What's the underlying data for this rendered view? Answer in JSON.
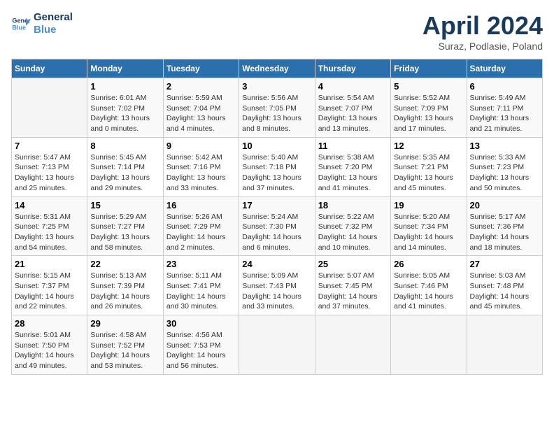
{
  "header": {
    "logo_line1": "General",
    "logo_line2": "Blue",
    "title": "April 2024",
    "subtitle": "Suraz, Podlasie, Poland"
  },
  "calendar": {
    "days_of_week": [
      "Sunday",
      "Monday",
      "Tuesday",
      "Wednesday",
      "Thursday",
      "Friday",
      "Saturday"
    ],
    "weeks": [
      [
        {
          "day": "",
          "info": ""
        },
        {
          "day": "1",
          "info": "Sunrise: 6:01 AM\nSunset: 7:02 PM\nDaylight: 13 hours\nand 0 minutes."
        },
        {
          "day": "2",
          "info": "Sunrise: 5:59 AM\nSunset: 7:04 PM\nDaylight: 13 hours\nand 4 minutes."
        },
        {
          "day": "3",
          "info": "Sunrise: 5:56 AM\nSunset: 7:05 PM\nDaylight: 13 hours\nand 8 minutes."
        },
        {
          "day": "4",
          "info": "Sunrise: 5:54 AM\nSunset: 7:07 PM\nDaylight: 13 hours\nand 13 minutes."
        },
        {
          "day": "5",
          "info": "Sunrise: 5:52 AM\nSunset: 7:09 PM\nDaylight: 13 hours\nand 17 minutes."
        },
        {
          "day": "6",
          "info": "Sunrise: 5:49 AM\nSunset: 7:11 PM\nDaylight: 13 hours\nand 21 minutes."
        }
      ],
      [
        {
          "day": "7",
          "info": "Sunrise: 5:47 AM\nSunset: 7:13 PM\nDaylight: 13 hours\nand 25 minutes."
        },
        {
          "day": "8",
          "info": "Sunrise: 5:45 AM\nSunset: 7:14 PM\nDaylight: 13 hours\nand 29 minutes."
        },
        {
          "day": "9",
          "info": "Sunrise: 5:42 AM\nSunset: 7:16 PM\nDaylight: 13 hours\nand 33 minutes."
        },
        {
          "day": "10",
          "info": "Sunrise: 5:40 AM\nSunset: 7:18 PM\nDaylight: 13 hours\nand 37 minutes."
        },
        {
          "day": "11",
          "info": "Sunrise: 5:38 AM\nSunset: 7:20 PM\nDaylight: 13 hours\nand 41 minutes."
        },
        {
          "day": "12",
          "info": "Sunrise: 5:35 AM\nSunset: 7:21 PM\nDaylight: 13 hours\nand 45 minutes."
        },
        {
          "day": "13",
          "info": "Sunrise: 5:33 AM\nSunset: 7:23 PM\nDaylight: 13 hours\nand 50 minutes."
        }
      ],
      [
        {
          "day": "14",
          "info": "Sunrise: 5:31 AM\nSunset: 7:25 PM\nDaylight: 13 hours\nand 54 minutes."
        },
        {
          "day": "15",
          "info": "Sunrise: 5:29 AM\nSunset: 7:27 PM\nDaylight: 13 hours\nand 58 minutes."
        },
        {
          "day": "16",
          "info": "Sunrise: 5:26 AM\nSunset: 7:29 PM\nDaylight: 14 hours\nand 2 minutes."
        },
        {
          "day": "17",
          "info": "Sunrise: 5:24 AM\nSunset: 7:30 PM\nDaylight: 14 hours\nand 6 minutes."
        },
        {
          "day": "18",
          "info": "Sunrise: 5:22 AM\nSunset: 7:32 PM\nDaylight: 14 hours\nand 10 minutes."
        },
        {
          "day": "19",
          "info": "Sunrise: 5:20 AM\nSunset: 7:34 PM\nDaylight: 14 hours\nand 14 minutes."
        },
        {
          "day": "20",
          "info": "Sunrise: 5:17 AM\nSunset: 7:36 PM\nDaylight: 14 hours\nand 18 minutes."
        }
      ],
      [
        {
          "day": "21",
          "info": "Sunrise: 5:15 AM\nSunset: 7:37 PM\nDaylight: 14 hours\nand 22 minutes."
        },
        {
          "day": "22",
          "info": "Sunrise: 5:13 AM\nSunset: 7:39 PM\nDaylight: 14 hours\nand 26 minutes."
        },
        {
          "day": "23",
          "info": "Sunrise: 5:11 AM\nSunset: 7:41 PM\nDaylight: 14 hours\nand 30 minutes."
        },
        {
          "day": "24",
          "info": "Sunrise: 5:09 AM\nSunset: 7:43 PM\nDaylight: 14 hours\nand 33 minutes."
        },
        {
          "day": "25",
          "info": "Sunrise: 5:07 AM\nSunset: 7:45 PM\nDaylight: 14 hours\nand 37 minutes."
        },
        {
          "day": "26",
          "info": "Sunrise: 5:05 AM\nSunset: 7:46 PM\nDaylight: 14 hours\nand 41 minutes."
        },
        {
          "day": "27",
          "info": "Sunrise: 5:03 AM\nSunset: 7:48 PM\nDaylight: 14 hours\nand 45 minutes."
        }
      ],
      [
        {
          "day": "28",
          "info": "Sunrise: 5:01 AM\nSunset: 7:50 PM\nDaylight: 14 hours\nand 49 minutes."
        },
        {
          "day": "29",
          "info": "Sunrise: 4:58 AM\nSunset: 7:52 PM\nDaylight: 14 hours\nand 53 minutes."
        },
        {
          "day": "30",
          "info": "Sunrise: 4:56 AM\nSunset: 7:53 PM\nDaylight: 14 hours\nand 56 minutes."
        },
        {
          "day": "",
          "info": ""
        },
        {
          "day": "",
          "info": ""
        },
        {
          "day": "",
          "info": ""
        },
        {
          "day": "",
          "info": ""
        }
      ]
    ]
  }
}
